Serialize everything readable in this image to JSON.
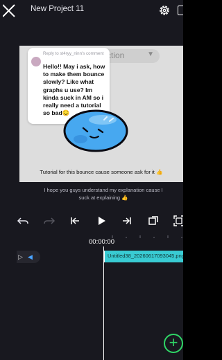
{
  "header": {
    "project_title": "New Project 11"
  },
  "preview": {
    "hidden_pill_text": "ction",
    "comment": {
      "reply_to": "Reply to st4ryy_ninn's comment",
      "body": "Hello!! May i ask, how to make them bounce slowly? Like what graphs u use? Im kinda suck in AM so i really need a tutorial so bad😔"
    },
    "caption": "Tutorial for this bounce cause someone ask for it 👍"
  },
  "subtitle": "I hope you guys understand my explanation cause I suck at explaining 👍",
  "toolbar": {
    "icons": [
      "undo-icon",
      "redo-icon",
      "skip-to-start-icon",
      "play-icon",
      "skip-to-end-icon",
      "keyframe-icon",
      "fullscreen-icon"
    ]
  },
  "timeline": {
    "timecode": "00:00:00",
    "clip_label": "Untitled38_20260617093045.png"
  },
  "colors": {
    "app_background": "#18181f",
    "canvas_background": "#dddddd",
    "clip_color": "#39cbd3",
    "add_button": "#2fd566",
    "blob": "#47a8f0"
  }
}
